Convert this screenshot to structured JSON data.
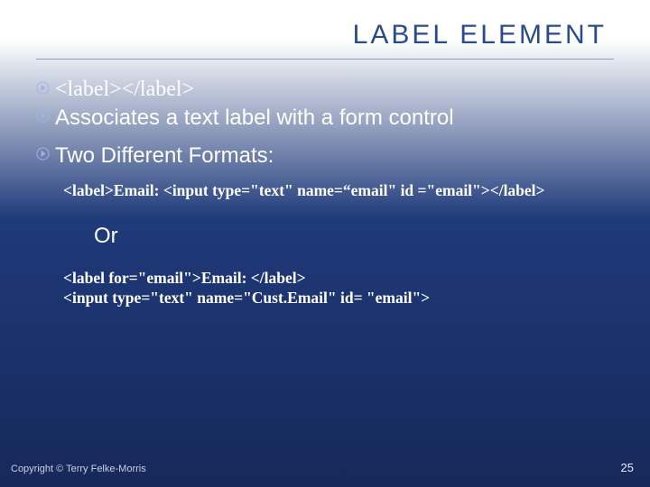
{
  "title": "LABEL ELEMENT",
  "bullets": [
    "<label></label>",
    "Associates a text label with a form control",
    "Two Different Formats:"
  ],
  "code_block_1": "<label>Email: <input type=\"text\" name=“email\"  id =\"email\"></label>",
  "or_text": "Or",
  "code_block_2_line1": "<label for=\"email\">Email: </label>",
  "code_block_2_line2": "<input type=\"text\" name=\"Cust.Email\" id= \"email\">",
  "footer_copyright": "Copyright © Terry Felke-Morris",
  "page_number": "25"
}
